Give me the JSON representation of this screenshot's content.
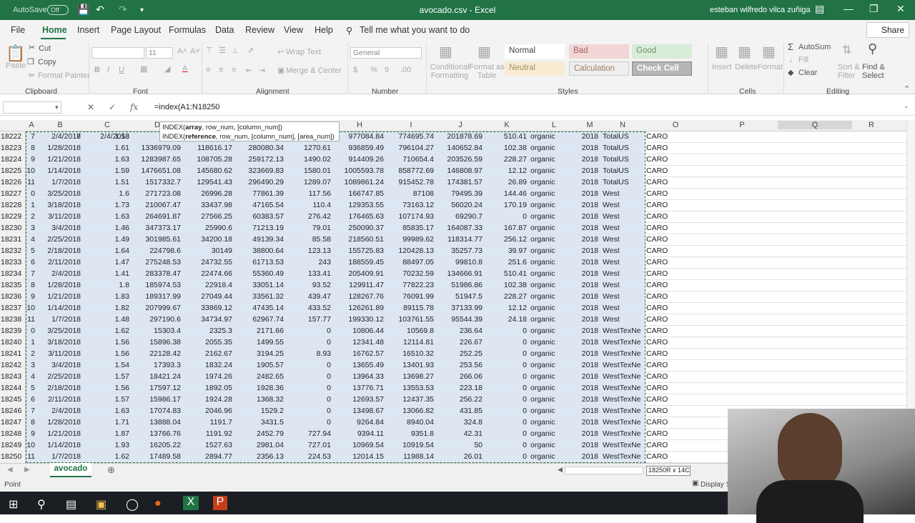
{
  "titlebar": {
    "autosave": "AutoSave",
    "autosave_state": "Off",
    "title": "avocado.csv  -  Excel",
    "user": "esteban wilfredo vilca zuñiga"
  },
  "menu": [
    "File",
    "Home",
    "Insert",
    "Page Layout",
    "Formulas",
    "Data",
    "Review",
    "View",
    "Help"
  ],
  "tell_me": "Tell me what you want to do",
  "share": "Share",
  "ribbon": {
    "clipboard": {
      "paste": "Paste",
      "cut": "Cut",
      "copy": "Copy",
      "format_painter": "Format Painter",
      "group": "Clipboard"
    },
    "font": {
      "size": "11",
      "group": "Font"
    },
    "alignment": {
      "wrap": "Wrap Text",
      "merge": "Merge & Center",
      "group": "Alignment"
    },
    "number": {
      "format": "General",
      "group": "Number"
    },
    "styles": {
      "conditional": "Conditional Formatting",
      "format_table": "Format as Table",
      "normal": "Normal",
      "bad": "Bad",
      "good": "Good",
      "neutral": "Neutral",
      "calculation": "Calculation",
      "check_cell": "Check Cell",
      "group": "Styles"
    },
    "cells": {
      "insert": "Insert",
      "delete": "Delete",
      "format": "Format",
      "group": "Cells"
    },
    "editing": {
      "autosum": "AutoSum",
      "fill": "Fill",
      "clear": "Clear",
      "sort": "Sort & Filter",
      "find": "Find & Select",
      "group": "Editing"
    }
  },
  "formula_bar": {
    "fx": "fx",
    "formula": "=index(A1:N18250"
  },
  "tooltip": {
    "line1_fn": "INDEX(",
    "line1_bold": "array",
    "line1_rest": ", row_num, [column_num])",
    "line2_fn": "INDEX(",
    "line2_bold": "reference",
    "line2_rest": ", row_num, [column_num], [area_num])"
  },
  "columns": [
    "A",
    "B",
    "C",
    "D",
    "E",
    "F",
    "G",
    "H",
    "I",
    "J",
    "K",
    "L",
    "M",
    "N",
    "O",
    "P",
    "Q",
    "R"
  ],
  "rows": [
    [
      "18222",
      "7",
      "2/4/2018",
      "1.53",
      "1384",
      "",
      "",
      "977084.84",
      "774695.74",
      "201878.69",
      "510.41",
      "organic",
      "2018",
      "TotalUS",
      "CARO"
    ],
    [
      "18223",
      "8",
      "1/28/2018",
      "1.61",
      "1336979.09",
      "118616.17",
      "280080.34",
      "1270.61",
      "936859.49",
      "796104.27",
      "140652.84",
      "102.38",
      "organic",
      "2018",
      "TotalUS",
      "CARO"
    ],
    [
      "18224",
      "9",
      "1/21/2018",
      "1.63",
      "1283987.65",
      "108705.28",
      "259172.13",
      "1490.02",
      "914409.26",
      "710654.4",
      "203526.59",
      "228.27",
      "organic",
      "2018",
      "TotalUS",
      "CARO"
    ],
    [
      "18225",
      "10",
      "1/14/2018",
      "1.59",
      "1476651.08",
      "145680.62",
      "323669.83",
      "1580.01",
      "1005593.78",
      "858772.69",
      "146808.97",
      "12.12",
      "organic",
      "2018",
      "TotalUS",
      "CARO"
    ],
    [
      "18226",
      "11",
      "1/7/2018",
      "1.51",
      "1517332.7",
      "129541.43",
      "296490.29",
      "1289.07",
      "1089861.24",
      "915452.78",
      "174381.57",
      "26.89",
      "organic",
      "2018",
      "TotalUS",
      "CARO"
    ],
    [
      "18227",
      "0",
      "3/25/2018",
      "1.6",
      "271723.08",
      "26996.28",
      "77861.39",
      "117.56",
      "166747.85",
      "87108",
      "79495.39",
      "144.46",
      "organic",
      "2018",
      "West",
      "CARO"
    ],
    [
      "18228",
      "1",
      "3/18/2018",
      "1.73",
      "210067.47",
      "33437.98",
      "47165.54",
      "110.4",
      "129353.55",
      "73163.12",
      "56020.24",
      "170.19",
      "organic",
      "2018",
      "West",
      "CARO"
    ],
    [
      "18229",
      "2",
      "3/11/2018",
      "1.63",
      "264691.87",
      "27566.25",
      "60383.57",
      "276.42",
      "176465.63",
      "107174.93",
      "69290.7",
      "0",
      "organic",
      "2018",
      "West",
      "CARO"
    ],
    [
      "18230",
      "3",
      "3/4/2018",
      "1.46",
      "347373.17",
      "25990.6",
      "71213.19",
      "79.01",
      "250090.37",
      "85835.17",
      "164087.33",
      "167.87",
      "organic",
      "2018",
      "West",
      "CARO"
    ],
    [
      "18231",
      "4",
      "2/25/2018",
      "1.49",
      "301985.61",
      "34200.18",
      "49139.34",
      "85.58",
      "218560.51",
      "99989.62",
      "118314.77",
      "256.12",
      "organic",
      "2018",
      "West",
      "CARO"
    ],
    [
      "18232",
      "5",
      "2/18/2018",
      "1.64",
      "224798.6",
      "30149",
      "38800.64",
      "123.13",
      "155725.83",
      "120428.13",
      "35257.73",
      "39.97",
      "organic",
      "2018",
      "West",
      "CARO"
    ],
    [
      "18233",
      "6",
      "2/11/2018",
      "1.47",
      "275248.53",
      "24732.55",
      "61713.53",
      "243",
      "188559.45",
      "88497.05",
      "99810.8",
      "251.6",
      "organic",
      "2018",
      "West",
      "CARO"
    ],
    [
      "18234",
      "7",
      "2/4/2018",
      "1.41",
      "283378.47",
      "22474.66",
      "55360.49",
      "133.41",
      "205409.91",
      "70232.59",
      "134666.91",
      "510.41",
      "organic",
      "2018",
      "West",
      "CARO"
    ],
    [
      "18235",
      "8",
      "1/28/2018",
      "1.8",
      "185974.53",
      "22918.4",
      "33051.14",
      "93.52",
      "129911.47",
      "77822.23",
      "51986.86",
      "102.38",
      "organic",
      "2018",
      "West",
      "CARO"
    ],
    [
      "18236",
      "9",
      "1/21/2018",
      "1.83",
      "189317.99",
      "27049.44",
      "33561.32",
      "439.47",
      "128267.76",
      "76091.99",
      "51947.5",
      "228.27",
      "organic",
      "2018",
      "West",
      "CARO"
    ],
    [
      "18237",
      "10",
      "1/14/2018",
      "1.82",
      "207999.67",
      "33869.12",
      "47435.14",
      "433.52",
      "126261.89",
      "89115.78",
      "37133.99",
      "12.12",
      "organic",
      "2018",
      "West",
      "CARO"
    ],
    [
      "18238",
      "11",
      "1/7/2018",
      "1.48",
      "297190.6",
      "34734.97",
      "62967.74",
      "157.77",
      "199330.12",
      "103761.55",
      "95544.39",
      "24.18",
      "organic",
      "2018",
      "West",
      "CARO"
    ],
    [
      "18239",
      "0",
      "3/25/2018",
      "1.62",
      "15303.4",
      "2325.3",
      "2171.66",
      "0",
      "10806.44",
      "10569.8",
      "236.64",
      "0",
      "organic",
      "2018",
      "WestTexNe",
      "CARO"
    ],
    [
      "18240",
      "1",
      "3/18/2018",
      "1.56",
      "15896.38",
      "2055.35",
      "1499.55",
      "0",
      "12341.48",
      "12114.81",
      "226.67",
      "0",
      "organic",
      "2018",
      "WestTexNe",
      "CARO"
    ],
    [
      "18241",
      "2",
      "3/11/2018",
      "1.56",
      "22128.42",
      "2162.67",
      "3194.25",
      "8.93",
      "16762.57",
      "16510.32",
      "252.25",
      "0",
      "organic",
      "2018",
      "WestTexNe",
      "CARO"
    ],
    [
      "18242",
      "3",
      "3/4/2018",
      "1.54",
      "17393.3",
      "1832.24",
      "1905.57",
      "0",
      "13655.49",
      "13401.93",
      "253.56",
      "0",
      "organic",
      "2018",
      "WestTexNe",
      "CARO"
    ],
    [
      "18243",
      "4",
      "2/25/2018",
      "1.57",
      "18421.24",
      "1974.26",
      "2482.65",
      "0",
      "13964.33",
      "13698.27",
      "266.06",
      "0",
      "organic",
      "2018",
      "WestTexNe",
      "CARO"
    ],
    [
      "18244",
      "5",
      "2/18/2018",
      "1.56",
      "17597.12",
      "1892.05",
      "1928.36",
      "0",
      "13776.71",
      "13553.53",
      "223.18",
      "0",
      "organic",
      "2018",
      "WestTexNe",
      "CARO"
    ],
    [
      "18245",
      "6",
      "2/11/2018",
      "1.57",
      "15986.17",
      "1924.28",
      "1368.32",
      "0",
      "12693.57",
      "12437.35",
      "256.22",
      "0",
      "organic",
      "2018",
      "WestTexNe",
      "CARO"
    ],
    [
      "18246",
      "7",
      "2/4/2018",
      "1.63",
      "17074.83",
      "2046.96",
      "1529.2",
      "0",
      "13498.67",
      "13066.82",
      "431.85",
      "0",
      "organic",
      "2018",
      "WestTexNe",
      "CARO"
    ],
    [
      "18247",
      "8",
      "1/28/2018",
      "1.71",
      "13888.04",
      "1191.7",
      "3431.5",
      "0",
      "9264.84",
      "8940.04",
      "324.8",
      "0",
      "organic",
      "2018",
      "WestTexNe",
      "CARO"
    ],
    [
      "18248",
      "9",
      "1/21/2018",
      "1.87",
      "13766.76",
      "1191.92",
      "2452.79",
      "727.94",
      "9394.11",
      "9351.8",
      "42.31",
      "0",
      "organic",
      "2018",
      "WestTexNe",
      "CARO"
    ],
    [
      "18249",
      "10",
      "1/14/2018",
      "1.93",
      "16205.22",
      "1527.63",
      "2981.04",
      "727.01",
      "10969.54",
      "10919.54",
      "50",
      "0",
      "organic",
      "2018",
      "WestTexNe",
      "CARO"
    ],
    [
      "18250",
      "11",
      "1/7/2018",
      "1.62",
      "17489.58",
      "2894.77",
      "2356.13",
      "224.53",
      "12014.15",
      "11988.14",
      "26.01",
      "0",
      "organic",
      "2018",
      "WestTexNe",
      "CARO"
    ]
  ],
  "sheet_tab": "avocado",
  "size_tip": "18250R x 14C",
  "status": {
    "mode": "Point",
    "display": "Display Se"
  }
}
